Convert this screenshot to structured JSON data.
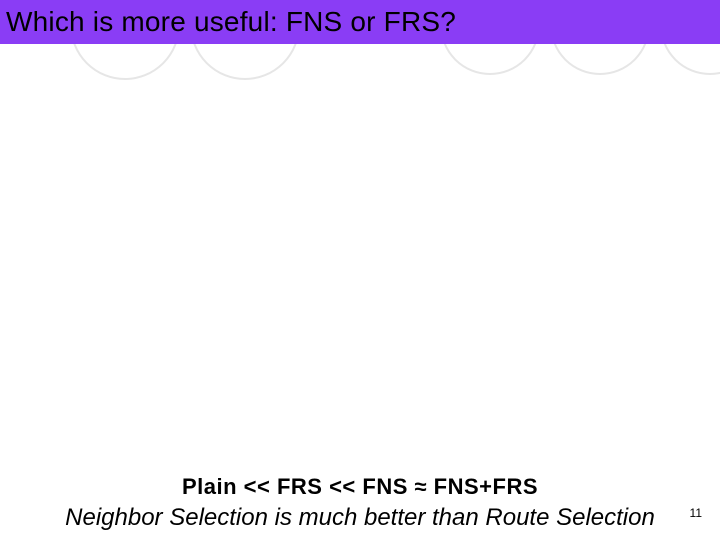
{
  "title": "Which is more useful: FNS or FRS?",
  "comparison": "Plain  <<   FRS   <<  FNS ≈ FNS+FRS",
  "conclusion": "Neighbor Selection is much better than Route Selection",
  "page_number": "11"
}
